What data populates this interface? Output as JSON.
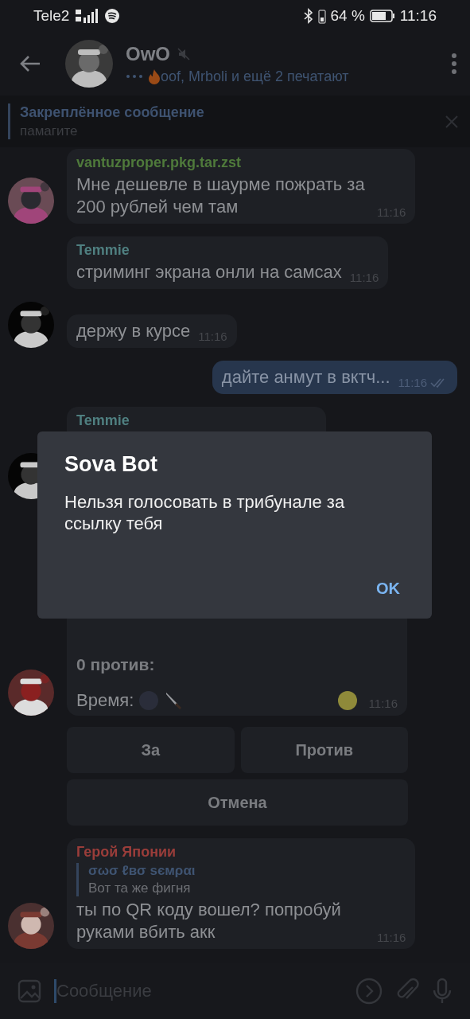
{
  "status_bar": {
    "carrier": "Tele2",
    "battery": "64 %",
    "time": "11:16"
  },
  "header": {
    "title": "OwO",
    "muted": true,
    "typing": "oof, Mrboli и ещё 2 печатают"
  },
  "pinned": {
    "title": "Закреплённое сообщение",
    "text": "памагите"
  },
  "messages": [
    {
      "kind": "incoming",
      "avatar": true,
      "sender": "vantuzproper.pkg.tar.zst",
      "color": "#4f7a3b",
      "text": "Мне дешевле в шаурме пожрать за 200 рублей чем там",
      "time": "11:16"
    },
    {
      "kind": "incoming",
      "avatar": false,
      "sender": "Temmie",
      "color": "#4f7f80",
      "text": "стриминг экрана онли на самсах",
      "time": "11:16"
    },
    {
      "kind": "incoming",
      "avatar": true,
      "text": "держу в курсе",
      "time": "11:16"
    },
    {
      "kind": "outgoing",
      "text": "дайте анмут в вктч...",
      "time": "11:16",
      "read": true
    },
    {
      "kind": "covered",
      "avatar": true,
      "sender": "Temmie",
      "color": "#4f7f80"
    },
    {
      "kind": "vote",
      "avatar": true,
      "tally": "0 против:",
      "label": "Время:",
      "time": "11:16"
    },
    {
      "kind": "keyboard",
      "rows": [
        [
          "За",
          "Против"
        ],
        [
          "Отмена"
        ]
      ]
    },
    {
      "kind": "incoming",
      "avatar": true,
      "sender": "Герой Японии",
      "color": "#9a3d3a",
      "reply": {
        "name": "σωσ ℓвσ ѕємραι",
        "text": "Вот та же фигня"
      },
      "text": "ты по QR коду вошел? попробуй руками вбить акк",
      "time": "11:16"
    }
  ],
  "composer": {
    "placeholder": "Сообщение"
  },
  "dialog": {
    "title": "Sova Bot",
    "text": "Нельзя голосовать в трибунале за ссылку тебя",
    "button": "OK"
  }
}
